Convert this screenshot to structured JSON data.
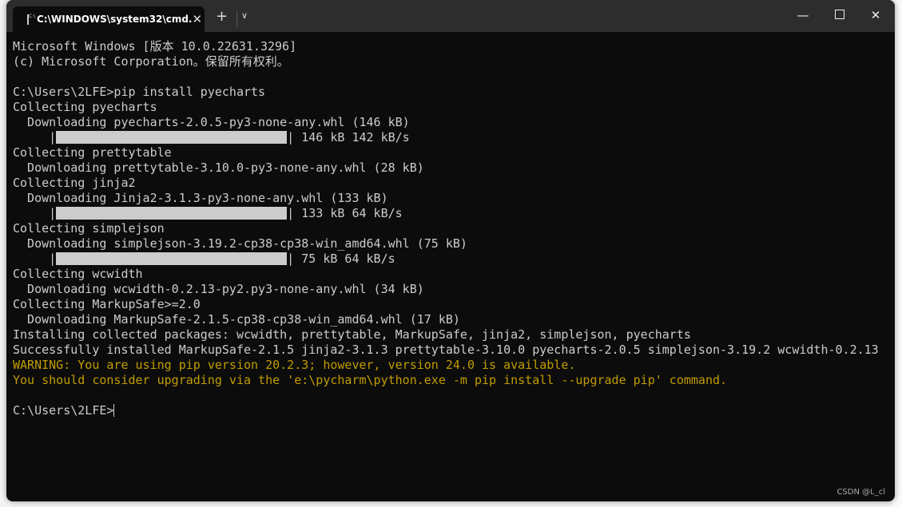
{
  "window": {
    "tab_title": "C:\\WINDOWS\\system32\\cmd.",
    "icons": {
      "tab": "cmd-icon",
      "close_tab": "close-icon",
      "new_tab": "plus-icon",
      "dropdown": "chevron-down-icon",
      "minimize": "minimize-icon",
      "maximize": "maximize-icon",
      "close": "close-icon"
    },
    "glyphs": {
      "close_tab": "✕",
      "new_tab": "+",
      "dropdown": "⌄",
      "minimize": "—",
      "close": "✕"
    }
  },
  "terminal": {
    "lines": [
      {
        "text": "Microsoft Windows [版本 10.0.22631.3296]"
      },
      {
        "text": "(c) Microsoft Corporation。保留所有权利。"
      },
      {
        "text": ""
      },
      {
        "text": "C:\\Users\\2LFE>pip install pyecharts"
      },
      {
        "text": "Collecting pyecharts"
      },
      {
        "text": "  Downloading pyecharts-2.0.5-py3-none-any.whl (146 kB)"
      },
      {
        "prefix": "     |",
        "progress_percent": 100,
        "text": "| 146 kB 142 kB/s"
      },
      {
        "text": "Collecting prettytable"
      },
      {
        "text": "  Downloading prettytable-3.10.0-py3-none-any.whl (28 kB)"
      },
      {
        "text": "Collecting jinja2"
      },
      {
        "text": "  Downloading Jinja2-3.1.3-py3-none-any.whl (133 kB)"
      },
      {
        "prefix": "     |",
        "progress_percent": 100,
        "text": "| 133 kB 64 kB/s"
      },
      {
        "text": "Collecting simplejson"
      },
      {
        "text": "  Downloading simplejson-3.19.2-cp38-cp38-win_amd64.whl (75 kB)"
      },
      {
        "prefix": "     |",
        "progress_percent": 100,
        "text": "| 75 kB 64 kB/s"
      },
      {
        "text": "Collecting wcwidth"
      },
      {
        "text": "  Downloading wcwidth-0.2.13-py2.py3-none-any.whl (34 kB)"
      },
      {
        "text": "Collecting MarkupSafe>=2.0"
      },
      {
        "text": "  Downloading MarkupSafe-2.1.5-cp38-cp38-win_amd64.whl (17 kB)"
      },
      {
        "text": "Installing collected packages: wcwidth, prettytable, MarkupSafe, jinja2, simplejson, pyecharts"
      },
      {
        "text": "Successfully installed MarkupSafe-2.1.5 jinja2-3.1.3 prettytable-3.10.0 pyecharts-2.0.5 simplejson-3.19.2 wcwidth-0.2.13"
      },
      {
        "text": "WARNING: You are using pip version 20.2.3; however, version 24.0 is available.",
        "warn": true
      },
      {
        "text": "You should consider upgrading via the 'e:\\pycharm\\python.exe -m pip install --upgrade pip' command.",
        "warn": true
      },
      {
        "text": ""
      },
      {
        "text": "C:\\Users\\2LFE>",
        "cursor": true
      }
    ]
  },
  "colors": {
    "background": "#0c0c0c",
    "text": "#cccccc",
    "warning": "#c19c00",
    "titlebar": "#2d2d2d"
  },
  "watermark": "CSDN @L_cl"
}
